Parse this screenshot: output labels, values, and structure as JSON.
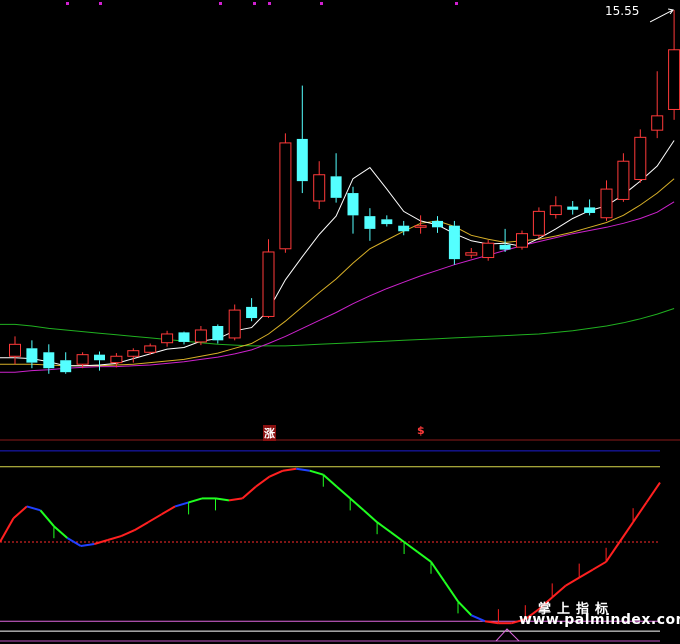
{
  "chart_data": [
    {
      "type": "candlestick",
      "panel": "price",
      "price_label": "15.55",
      "markers": [
        "涨",
        "$"
      ],
      "candles": [
        {
          "o": 11.2,
          "h": 11.45,
          "l": 11.1,
          "c": 11.35
        },
        {
          "o": 11.3,
          "h": 11.4,
          "l": 11.05,
          "c": 11.12
        },
        {
          "o": 11.25,
          "h": 11.35,
          "l": 10.98,
          "c": 11.05
        },
        {
          "o": 11.15,
          "h": 11.25,
          "l": 10.98,
          "c": 11.0
        },
        {
          "o": 11.1,
          "h": 11.25,
          "l": 11.05,
          "c": 11.22
        },
        {
          "o": 11.22,
          "h": 11.26,
          "l": 11.02,
          "c": 11.15
        },
        {
          "o": 11.12,
          "h": 11.24,
          "l": 11.06,
          "c": 11.2
        },
        {
          "o": 11.2,
          "h": 11.3,
          "l": 11.12,
          "c": 11.27
        },
        {
          "o": 11.25,
          "h": 11.36,
          "l": 11.22,
          "c": 11.33
        },
        {
          "o": 11.37,
          "h": 11.52,
          "l": 11.32,
          "c": 11.48
        },
        {
          "o": 11.5,
          "h": 11.51,
          "l": 11.35,
          "c": 11.38
        },
        {
          "o": 11.38,
          "h": 11.58,
          "l": 11.34,
          "c": 11.53
        },
        {
          "o": 11.58,
          "h": 11.6,
          "l": 11.36,
          "c": 11.4
        },
        {
          "o": 11.43,
          "h": 11.85,
          "l": 11.4,
          "c": 11.78
        },
        {
          "o": 11.82,
          "h": 11.93,
          "l": 11.64,
          "c": 11.68
        },
        {
          "o": 11.7,
          "h": 12.67,
          "l": 11.68,
          "c": 12.51
        },
        {
          "o": 12.55,
          "h": 14.0,
          "l": 12.5,
          "c": 13.88
        },
        {
          "o": 13.93,
          "h": 14.6,
          "l": 13.25,
          "c": 13.4
        },
        {
          "o": 13.15,
          "h": 13.65,
          "l": 13.05,
          "c": 13.48
        },
        {
          "o": 13.46,
          "h": 13.75,
          "l": 13.13,
          "c": 13.19
        },
        {
          "o": 13.25,
          "h": 13.33,
          "l": 12.74,
          "c": 12.97
        },
        {
          "o": 12.96,
          "h": 13.06,
          "l": 12.65,
          "c": 12.8
        },
        {
          "o": 12.92,
          "h": 12.97,
          "l": 12.83,
          "c": 12.86
        },
        {
          "o": 12.84,
          "h": 12.9,
          "l": 12.72,
          "c": 12.77
        },
        {
          "o": 12.82,
          "h": 12.97,
          "l": 12.74,
          "c": 12.84
        },
        {
          "o": 12.9,
          "h": 12.96,
          "l": 12.75,
          "c": 12.82
        },
        {
          "o": 12.84,
          "h": 12.9,
          "l": 12.35,
          "c": 12.42
        },
        {
          "o": 12.47,
          "h": 12.56,
          "l": 12.43,
          "c": 12.5
        },
        {
          "o": 12.44,
          "h": 12.66,
          "l": 12.4,
          "c": 12.62
        },
        {
          "o": 12.6,
          "h": 12.8,
          "l": 12.51,
          "c": 12.54
        },
        {
          "o": 12.57,
          "h": 12.78,
          "l": 12.54,
          "c": 12.74
        },
        {
          "o": 12.72,
          "h": 13.07,
          "l": 12.68,
          "c": 13.02
        },
        {
          "o": 12.98,
          "h": 13.21,
          "l": 12.93,
          "c": 13.09
        },
        {
          "o": 13.08,
          "h": 13.15,
          "l": 12.98,
          "c": 13.04
        },
        {
          "o": 13.07,
          "h": 13.17,
          "l": 12.97,
          "c": 13.0
        },
        {
          "o": 12.94,
          "h": 13.41,
          "l": 12.9,
          "c": 13.3
        },
        {
          "o": 13.17,
          "h": 13.75,
          "l": 13.14,
          "c": 13.65
        },
        {
          "o": 13.42,
          "h": 14.05,
          "l": 13.38,
          "c": 13.95
        },
        {
          "o": 14.04,
          "h": 14.78,
          "l": 13.94,
          "c": 14.22
        },
        {
          "o": 14.3,
          "h": 15.55,
          "l": 14.17,
          "c": 15.05
        }
      ],
      "ma_white": [
        11.18,
        11.17,
        11.13,
        11.08,
        11.08,
        11.09,
        11.11,
        11.17,
        11.23,
        11.29,
        11.31,
        11.39,
        11.42,
        11.52,
        11.56,
        11.78,
        12.16,
        12.45,
        12.73,
        12.96,
        13.43,
        13.57,
        13.3,
        13.02,
        12.9,
        12.85,
        12.74,
        12.65,
        12.61,
        12.62,
        12.58,
        12.68,
        12.8,
        12.93,
        13.03,
        13.09,
        13.23,
        13.4,
        13.59,
        13.91
      ],
      "ma_yellow": [
        11.1,
        11.1,
        11.09,
        11.08,
        11.08,
        11.08,
        11.09,
        11.1,
        11.12,
        11.14,
        11.16,
        11.2,
        11.24,
        11.3,
        11.36,
        11.48,
        11.64,
        11.82,
        12.0,
        12.17,
        12.37,
        12.55,
        12.66,
        12.77,
        12.87,
        12.9,
        12.83,
        12.72,
        12.67,
        12.63,
        12.65,
        12.67,
        12.71,
        12.76,
        12.82,
        12.88,
        12.97,
        13.1,
        13.25,
        13.43
      ],
      "ma_magenta": [
        11.0,
        11.02,
        11.03,
        11.05,
        11.06,
        11.07,
        11.07,
        11.08,
        11.09,
        11.11,
        11.13,
        11.16,
        11.19,
        11.23,
        11.28,
        11.36,
        11.45,
        11.55,
        11.65,
        11.75,
        11.86,
        11.96,
        12.05,
        12.13,
        12.21,
        12.28,
        12.35,
        12.41,
        12.47,
        12.53,
        12.59,
        12.64,
        12.69,
        12.74,
        12.78,
        12.82,
        12.87,
        12.93,
        13.01,
        13.14
      ],
      "ma_green": [
        11.6,
        11.58,
        11.55,
        11.53,
        11.51,
        11.49,
        11.47,
        11.45,
        11.43,
        11.41,
        11.39,
        11.37,
        11.35,
        11.34,
        11.33,
        11.33,
        11.33,
        11.34,
        11.35,
        11.36,
        11.37,
        11.38,
        11.39,
        11.4,
        11.41,
        11.42,
        11.43,
        11.44,
        11.45,
        11.46,
        11.47,
        11.48,
        11.5,
        11.52,
        11.55,
        11.58,
        11.62,
        11.67,
        11.73,
        11.8
      ]
    },
    {
      "type": "line",
      "panel": "indicator",
      "ylim": [
        0,
        100
      ],
      "reference_lines": [
        {
          "name": "",
          "value": 96,
          "color": "#1c1ccf"
        },
        {
          "name": "",
          "value": 88,
          "color": "#d8d84a"
        },
        {
          "name": "",
          "value": 50,
          "color": "#ff2a2a",
          "style": "dashed"
        },
        {
          "name": "",
          "value": 10,
          "color": "#dd66dd"
        },
        {
          "name": "",
          "value": 5,
          "color": "#ffffff"
        },
        {
          "name": "",
          "value": 0,
          "color": "#c050c0"
        }
      ],
      "values": [
        50,
        62,
        68,
        66,
        58,
        52,
        48,
        49,
        51,
        53,
        56,
        60,
        64,
        68,
        70,
        72,
        72,
        71,
        72,
        78,
        83,
        86,
        87,
        86,
        84,
        78,
        72,
        66,
        60,
        55,
        50,
        45,
        40,
        30,
        20,
        13,
        10,
        9,
        9,
        11,
        16,
        22,
        28,
        32,
        36,
        40,
        50,
        60,
        70,
        80
      ],
      "segment_colors": [
        "red",
        "red",
        "blue",
        "green",
        "green",
        "blue",
        "blue",
        "red",
        "red",
        "red",
        "red",
        "red",
        "red",
        "blue",
        "green",
        "green",
        "green",
        "red",
        "red",
        "red",
        "red",
        "red",
        "blue",
        "green",
        "green",
        "green",
        "green",
        "green",
        "green",
        "green",
        "green",
        "green",
        "green",
        "green",
        "green",
        "blue",
        "red",
        "red",
        "red",
        "red",
        "red",
        "red",
        "red",
        "red",
        "red",
        "red",
        "red",
        "red",
        "red"
      ]
    }
  ],
  "watermark": {
    "line1": "掌上指标",
    "line2": "www.palmindex.com"
  },
  "colors": {
    "background": "#000000",
    "up_candle": "#ff3a3a",
    "down_candle": "#54ffff",
    "ma_white": "#ffffff",
    "ma_yellow": "#d8b028",
    "ma_magenta": "#cc22cc",
    "ma_green": "#20b020",
    "separator": "#8a1a1a",
    "signal_up": "#ff2020",
    "signal_down": "#20ff20",
    "signal_flat": "#2040ff"
  }
}
